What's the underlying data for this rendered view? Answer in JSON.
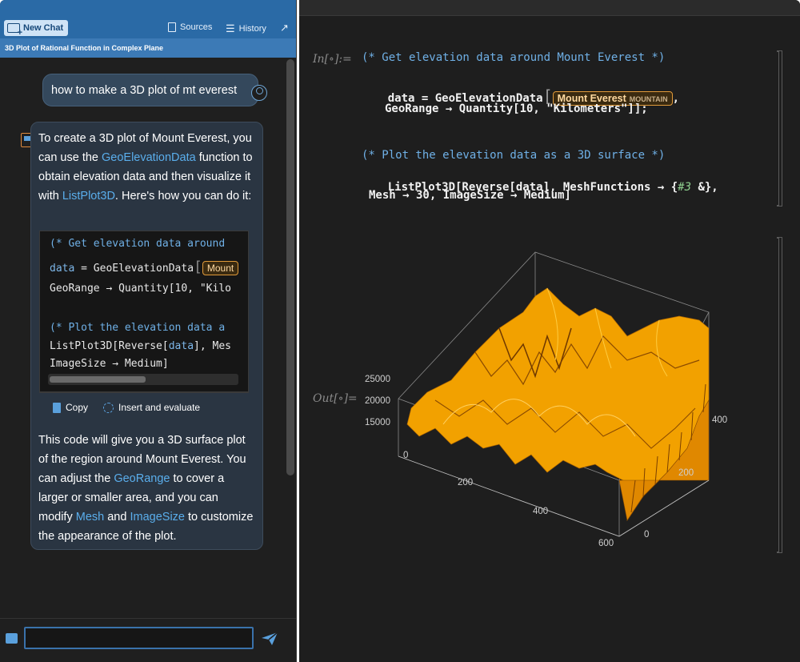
{
  "toolbar": {
    "new_chat": "New Chat",
    "sources": "Sources",
    "history": "History"
  },
  "conversation": {
    "title": "3D Plot of Rational Function in Complex Plane",
    "user_message": "how to make a 3D plot of mt everest",
    "assistant": {
      "p1_a": "To create a 3D plot of Mount Everest, you can use the ",
      "p1_link1": "GeoElevationData",
      "p1_b": " function to obtain elevation data and then visualize it with ",
      "p1_link2": "ListPlot3D",
      "p1_c": ". Here's how you can do it:",
      "code_lines": [
        "(* Get elevation data around",
        "GeoRange → Quantity[10, \"Kilo",
        "(* Plot the elevation data a",
        "ImageSize → Medium]"
      ],
      "code_line2_a": "data",
      "code_line2_b": " = GeoElevationData",
      "code_line2_entity": "Mount",
      "code_line5_a": "ListPlot3D[Reverse[",
      "code_line5_var": "data",
      "code_line5_b": "], Mes",
      "copy": "Copy",
      "insert": "Insert and evaluate",
      "p2_a": "This code will give you a 3D surface plot of the region around Mount Everest. You can adjust the ",
      "p2_link1": "GeoRange",
      "p2_b": " to cover a larger or smaller area, and you can modify ",
      "p2_link2": "Mesh",
      "p2_c": " and ",
      "p2_link3": "ImageSize",
      "p2_d": " to customize the appearance of the plot."
    }
  },
  "input": {
    "value": ""
  },
  "notebook": {
    "in_label": "In[∘]:=",
    "out_label": "Out[∘]=",
    "line1": "(* Get elevation data around Mount Everest *)",
    "line2_a": "data = GeoElevationData",
    "entity_name": "Mount Everest",
    "entity_type": "MOUNTAIN",
    "line2_b": ",",
    "line3": "GeoRange → Quantity[10, \"Kilometers\"]];",
    "line4": "(* Plot the elevation data as a 3D surface *)",
    "line5_a": "ListPlot3D[Reverse[data], MeshFunctions → {",
    "line5_slot": "#3",
    "line5_b": " &},",
    "line6": "Mesh → 30, ImageSize → Medium]"
  },
  "plot": {
    "z_ticks": [
      "25000",
      "20000",
      "15000"
    ],
    "x_ticks": [
      "0",
      "200",
      "400",
      "600"
    ],
    "y_ticks": [
      "0",
      "200",
      "400"
    ],
    "surface_color": "#f2a100"
  }
}
